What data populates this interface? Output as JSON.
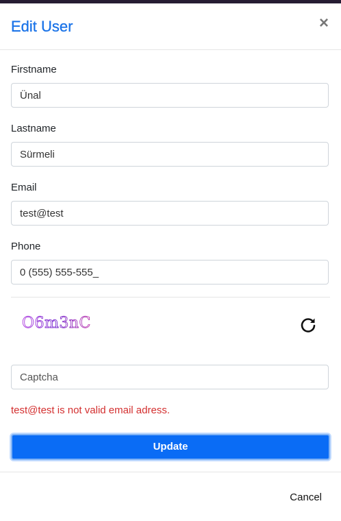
{
  "modal": {
    "title": "Edit User",
    "close_label": "×"
  },
  "form": {
    "firstname": {
      "label": "Firstname",
      "value": "Ünal"
    },
    "lastname": {
      "label": "Lastname",
      "value": "Sürmeli"
    },
    "email": {
      "label": "Email",
      "value": "test@test"
    },
    "phone": {
      "label": "Phone",
      "value": "0 (555) 555-555_"
    },
    "captcha": {
      "image_text": "O6m3nC",
      "placeholder": "Captcha",
      "value": ""
    },
    "error_message": "test@test is not valid email adress."
  },
  "buttons": {
    "update_label": "Update",
    "cancel_label": "Cancel"
  },
  "icons": {
    "close": "close-icon",
    "refresh": "refresh-icon"
  },
  "colors": {
    "title": "#1a73e8",
    "primary": "#0a6cf5",
    "error": "#d32f2f",
    "captcha_text": "#9b30d9"
  }
}
